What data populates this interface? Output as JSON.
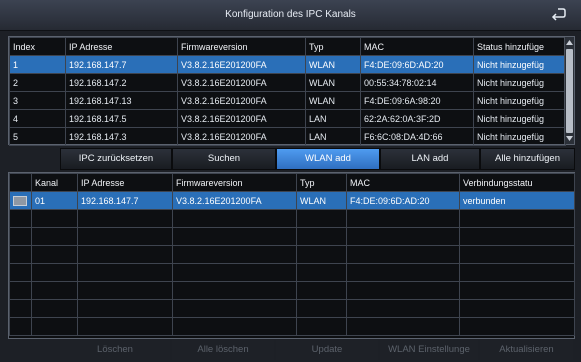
{
  "window": {
    "title": "Konfiguration des IPC Kanals",
    "back_icon": "return-icon"
  },
  "found_table": {
    "headers": [
      "Index",
      "IP Adresse",
      "Firmwareversion",
      "Typ",
      "MAC",
      "Status hinzufüge"
    ],
    "rows": [
      [
        "1",
        "192.168.147.7",
        "V3.8.2.16E201200FA",
        "WLAN",
        "F4:DE:09:6D:AD:20",
        "Nicht hinzugefüg"
      ],
      [
        "2",
        "192.168.147.2",
        "V3.8.2.16E201200FA",
        "WLAN",
        "00:55:34:78:02:14",
        "Nicht hinzugefüg"
      ],
      [
        "3",
        "192.168.147.13",
        "V3.8.2.16E201200FA",
        "WLAN",
        "F4:DE:09:6A:98:20",
        "Nicht hinzugefüg"
      ],
      [
        "4",
        "192.168.147.5",
        "V3.8.2.16E201200FA",
        "LAN",
        "62:2A:62:0A:3F:2D",
        "Nicht hinzugefüg"
      ],
      [
        "5",
        "192.168.147.3",
        "V3.8.2.16E201200FA",
        "LAN",
        "F6:6C:08:DA:4D:66",
        "Nicht hinzugefüg"
      ]
    ],
    "selected_row": 0
  },
  "actions": {
    "reset": "IPC zurücksetzen",
    "search": "Suchen",
    "wlan_add": "WLAN add",
    "lan_add": "LAN add",
    "add_all": "Alle hinzufügen"
  },
  "channel_table": {
    "headers": [
      "",
      "Kanal",
      "IP Adresse",
      "Firmwareversion",
      "Typ",
      "MAC",
      "Verbindungsstatu"
    ],
    "rows": [
      [
        "",
        "01",
        "192.168.147.7",
        "V3.8.2.16E201200FA",
        "WLAN",
        "F4:DE:09:6D:AD:20",
        "verbunden"
      ]
    ],
    "empty_rows": 7
  },
  "bottom_actions": {
    "delete": "Löschen",
    "delete_all": "Alle löschen",
    "update": "Update",
    "wlan_settings": "WLAN Einstellunge",
    "refresh": "Aktualisieren"
  },
  "colors": {
    "selected_row": "#2a6fb8",
    "active_button": "#3f86dd",
    "background": "#1d2026"
  }
}
